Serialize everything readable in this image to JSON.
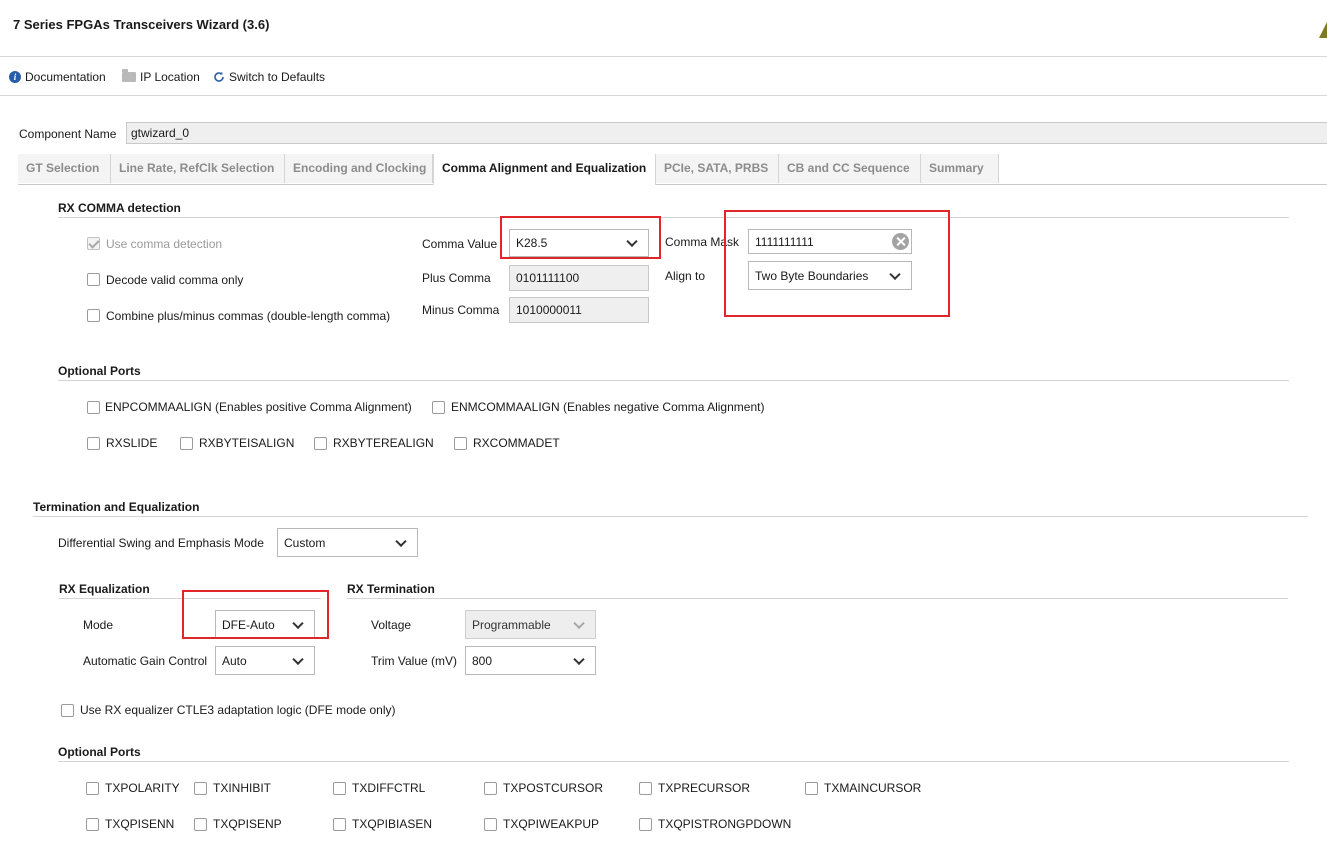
{
  "window": {
    "title": "7 Series FPGAs Transceivers Wizard (3.6)",
    "accent_color": "#7b7b25"
  },
  "toolbar": {
    "documentation": "Documentation",
    "ip_location": "IP Location",
    "switch_defaults": "Switch to Defaults"
  },
  "component": {
    "label": "Component Name",
    "value": "gtwizard_0"
  },
  "tabs": [
    {
      "label": "GT Selection"
    },
    {
      "label": "Line Rate, RefClk Selection"
    },
    {
      "label": "Encoding and Clocking"
    },
    {
      "label": "Comma Alignment and Equalization",
      "active": true
    },
    {
      "label": "PCIe, SATA, PRBS"
    },
    {
      "label": "CB and CC Sequence"
    },
    {
      "label": "Summary"
    }
  ],
  "rx_comma": {
    "title": "RX COMMA detection",
    "use_comma": {
      "label": "Use comma detection",
      "checked": true,
      "disabled": true
    },
    "decode_valid": {
      "label": "Decode valid comma only",
      "checked": false
    },
    "combine": {
      "label": "Combine plus/minus commas (double-length comma)",
      "checked": false
    },
    "comma_value_label": "Comma Value",
    "comma_value": "K28.5",
    "plus_comma_label": "Plus Comma",
    "plus_comma": "0101111100",
    "minus_comma_label": "Minus Comma",
    "minus_comma": "1010000011",
    "comma_mask_label": "Comma Mask",
    "comma_mask": "1111111111",
    "align_to_label": "Align to",
    "align_to": "Two Byte Boundaries"
  },
  "optional_ports_rx": {
    "title": "Optional Ports",
    "enpcomma": "ENPCOMMAALIGN (Enables positive Comma Alignment)",
    "enmcomma": "ENMCOMMAALIGN (Enables negative Comma Alignment)",
    "rxslide": "RXSLIDE",
    "rxbyteisalign": "RXBYTEISALIGN",
    "rxbyterealign": "RXBYTEREALIGN",
    "rxcommadet": "RXCOMMADET"
  },
  "termination": {
    "title": "Termination and Equalization",
    "diff_swing_label": "Differential Swing and Emphasis Mode",
    "diff_swing": "Custom",
    "rx_eq_title": "RX Equalization",
    "mode_label": "Mode",
    "mode": "DFE-Auto",
    "agc_label": "Automatic Gain Control",
    "agc": "Auto",
    "rx_term_title": "RX Termination",
    "voltage_label": "Voltage",
    "voltage": "Programmable",
    "trim_label": "Trim Value (mV)",
    "trim": "800",
    "ctle3": "Use RX equalizer CTLE3 adaptation logic (DFE mode only)"
  },
  "optional_ports_tx": {
    "title": "Optional Ports",
    "row1": [
      "TXPOLARITY",
      "TXINHIBIT",
      "TXDIFFCTRL",
      "TXPOSTCURSOR",
      "TXPRECURSOR",
      "TXMAINCURSOR"
    ],
    "row2": [
      "TXQPISENN",
      "TXQPISENP",
      "TXQPIBIASEN",
      "TXQPIWEAKPUP",
      "TXQPISTRONGPDOWN"
    ]
  },
  "highlight_color": "#e0262b"
}
